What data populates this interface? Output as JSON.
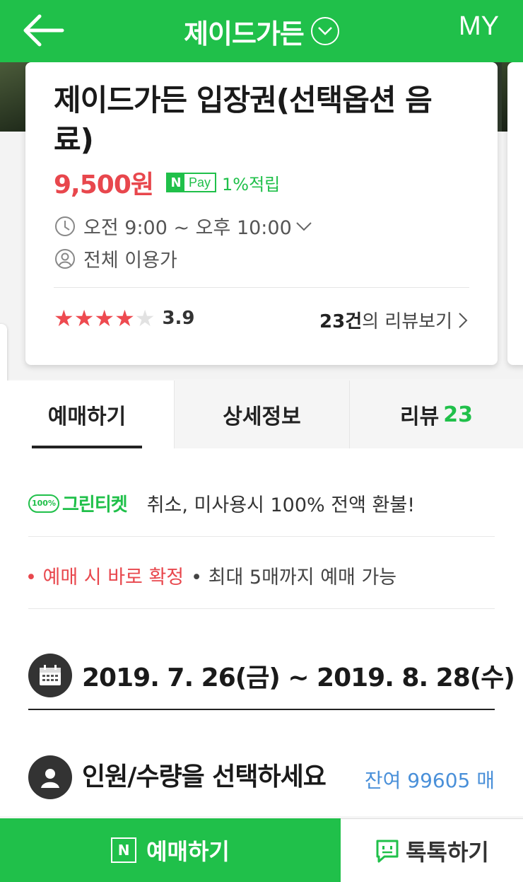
{
  "header": {
    "title": "제이드가든",
    "my_label": "MY"
  },
  "product": {
    "title": "제이드가든 입장권(선택옵션 음료)",
    "price": "9,500원",
    "npay_logo_n": "N",
    "npay_logo_text": "Pay",
    "npay_reward": "1%적립",
    "hours": "오전 9:00 ~ 오후 10:00",
    "age": "전체 이용가",
    "rating": "3.9",
    "stars_filled": 4,
    "stars_total": 5,
    "review_count": "23건",
    "review_link_suffix": "의 리뷰보기"
  },
  "tabs": [
    {
      "label": "예매하기",
      "active": true
    },
    {
      "label": "상세정보",
      "active": false
    },
    {
      "label": "리뷰",
      "count": "23",
      "active": false
    }
  ],
  "content": {
    "green_ticket_badge": "100%",
    "green_ticket_label": "그린티켓",
    "green_ticket_text": "취소, 미사용시 100% 전액 환불!",
    "notice_red": "• 예매 시 바로 확정",
    "notice_gray": "• 최대 5매까지 예매 가능",
    "date_range": "2019. 7. 26(금) ~ 2019. 8. 28(수)",
    "qty_label": "인원/수량을 선택하세요",
    "remaining": "잔여 99605 매"
  },
  "bottom": {
    "book_icon_letter": "N",
    "book_label": "예매하기",
    "talk_label": "톡톡하기"
  },
  "colors": {
    "brand_green": "#20c04a",
    "price_red": "#e8474d",
    "remain_blue": "#4a90d9"
  },
  "icons": [
    "back-arrow-icon",
    "chevron-down-icon",
    "clock-icon",
    "person-icon",
    "star-icon",
    "chevron-right-icon",
    "calendar-icon",
    "user-circle-icon",
    "naver-n-icon",
    "chat-bubble-icon"
  ]
}
